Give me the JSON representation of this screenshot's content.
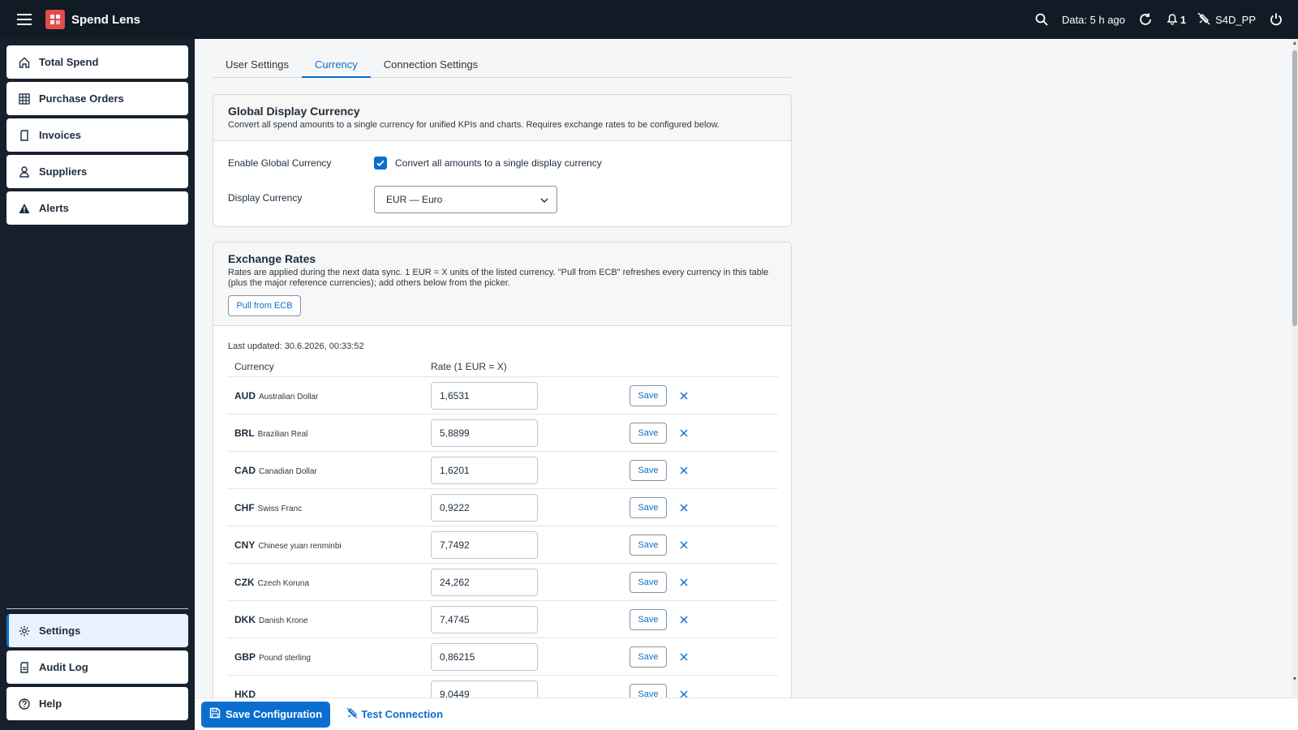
{
  "app": {
    "title": "Spend Lens"
  },
  "header": {
    "data_age": "Data: 5 h ago",
    "notification_count": "1",
    "user": "S4D_PP"
  },
  "sidebar": {
    "items": [
      {
        "label": "Total Spend",
        "icon": "home-icon"
      },
      {
        "label": "Purchase Orders",
        "icon": "grid-icon"
      },
      {
        "label": "Invoices",
        "icon": "document-icon"
      },
      {
        "label": "Suppliers",
        "icon": "person-icon"
      },
      {
        "label": "Alerts",
        "icon": "warning-icon"
      }
    ],
    "bottom_items": [
      {
        "label": "Settings",
        "icon": "gear-icon",
        "active": true
      },
      {
        "label": "Audit Log",
        "icon": "log-icon"
      },
      {
        "label": "Help",
        "icon": "help-icon"
      }
    ]
  },
  "tabs": [
    "User Settings",
    "Currency",
    "Connection Settings"
  ],
  "active_tab": "Currency",
  "global_currency": {
    "title": "Global Display Currency",
    "description": "Convert all spend amounts to a single currency for unified KPIs and charts. Requires exchange rates to be configured below.",
    "enable_label": "Enable Global Currency",
    "checkbox_label": "Convert all amounts to a single display currency",
    "checked": true,
    "display_label": "Display Currency",
    "display_value": "EUR — Euro"
  },
  "exchange_rates": {
    "title": "Exchange Rates",
    "description": "Rates are applied during the next data sync. 1 EUR = X units of the listed currency. \"Pull from ECB\" refreshes every currency in this table (plus the major reference currencies); add others below from the picker.",
    "pull_button": "Pull from ECB",
    "last_updated": "Last updated: 30.6.2026, 00:33:52",
    "columns": [
      "Currency",
      "Rate (1 EUR = X)"
    ],
    "save_label": "Save",
    "rows": [
      {
        "code": "AUD",
        "name": "Australian Dollar",
        "rate": "1,6531"
      },
      {
        "code": "BRL",
        "name": "Brazilian Real",
        "rate": "5,8899"
      },
      {
        "code": "CAD",
        "name": "Canadian Dollar",
        "rate": "1,6201"
      },
      {
        "code": "CHF",
        "name": "Swiss Franc",
        "rate": "0,9222"
      },
      {
        "code": "CNY",
        "name": "Chinese yuan renminbi",
        "rate": "7,7492"
      },
      {
        "code": "CZK",
        "name": "Czech Koruna",
        "rate": "24,262"
      },
      {
        "code": "DKK",
        "name": "Danish Krone",
        "rate": "7,4745"
      },
      {
        "code": "GBP",
        "name": "Pound sterling",
        "rate": "0,86215"
      },
      {
        "code": "HKD",
        "name": "",
        "rate": "9,0449"
      }
    ]
  },
  "footer": {
    "save_config": "Save Configuration",
    "test_connection": "Test Connection"
  },
  "colors": {
    "accent": "#0a6ed1",
    "topbar": "#111b26",
    "sidebar": "#17212e",
    "logo": "#e34b4b"
  }
}
